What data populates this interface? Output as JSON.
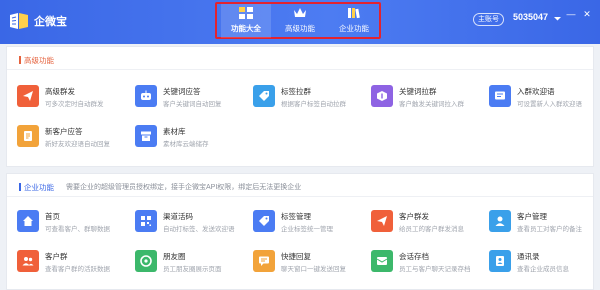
{
  "app": {
    "title": "企微宝"
  },
  "nav": {
    "tabs": [
      {
        "label": "功能大全",
        "icon": "grid-icon",
        "active": true
      },
      {
        "label": "高级功能",
        "icon": "crown-icon",
        "active": false
      },
      {
        "label": "企业功能",
        "icon": "books-icon",
        "active": false
      }
    ]
  },
  "account": {
    "badge": "主账号",
    "id": "5035047"
  },
  "window": {
    "minimize": "—",
    "close": "✕"
  },
  "sections": {
    "advanced": {
      "title": "高级功能",
      "items": [
        {
          "name": "高级群发",
          "desc": "可多次定时自动群发",
          "icon": "send-icon",
          "color": "#f0603a"
        },
        {
          "name": "关键词应答",
          "desc": "客户关键词自动回复",
          "icon": "robot-icon",
          "color": "#4b7cf3"
        },
        {
          "name": "标签拉群",
          "desc": "根据客户标签自动拉群",
          "icon": "tag-icon",
          "color": "#3aa0ea"
        },
        {
          "name": "关键词拉群",
          "desc": "客户触发关键词拉入群",
          "icon": "key-icon",
          "color": "#8e63e3"
        },
        {
          "name": "入群欢迎语",
          "desc": "可设置新人入群欢迎语",
          "icon": "welcome-icon",
          "color": "#4b7cf3"
        },
        {
          "name": "新客户应答",
          "desc": "新好友欢迎语自动回复",
          "icon": "document-icon",
          "color": "#f2a33a"
        },
        {
          "name": "素材库",
          "desc": "素材库云端储存",
          "icon": "archive-icon",
          "color": "#4b7cf3"
        }
      ]
    },
    "enterprise": {
      "title": "企业功能",
      "note": "需要企业的超级管理员授权绑定，接手企微宝API权限，绑定后无法更换企业",
      "items": [
        {
          "name": "首页",
          "desc": "可查看客户、群聊数据",
          "icon": "home-icon",
          "color": "#4b7cf3"
        },
        {
          "name": "渠道活码",
          "desc": "自动打标签、发送欢迎语",
          "icon": "qrcode-icon",
          "color": "#4b7cf3"
        },
        {
          "name": "标签管理",
          "desc": "企业标签统一管理",
          "icon": "tag-icon",
          "color": "#4b7cf3"
        },
        {
          "name": "客户群发",
          "desc": "给员工的客户群发消息",
          "icon": "send-icon",
          "color": "#f0603a"
        },
        {
          "name": "客户管理",
          "desc": "查看员工对客户的备注",
          "icon": "user-icon",
          "color": "#3aa0ea"
        },
        {
          "name": "客户群",
          "desc": "查看客户群的活跃数据",
          "icon": "group-icon",
          "color": "#f0603a"
        },
        {
          "name": "朋友圈",
          "desc": "员工朋友圈展示页面",
          "icon": "moments-icon",
          "color": "#3cb86b"
        },
        {
          "name": "快捷回复",
          "desc": "聊天窗口一键发送回复",
          "icon": "reply-icon",
          "color": "#f2a33a"
        },
        {
          "name": "会话存档",
          "desc": "员工与客户聊天记录存档",
          "icon": "archive-chat-icon",
          "color": "#3cb86b"
        },
        {
          "name": "通讯录",
          "desc": "查看企业成员信息",
          "icon": "contacts-icon",
          "color": "#3aa0ea"
        }
      ]
    }
  }
}
